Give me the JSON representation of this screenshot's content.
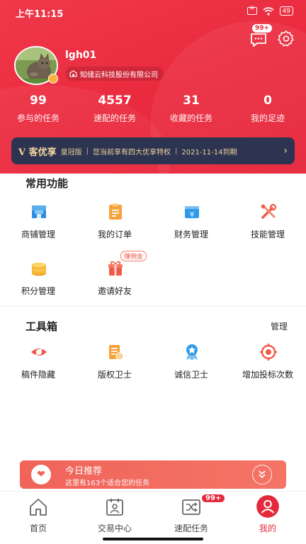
{
  "status": {
    "time": "上午11:15",
    "battery": "49"
  },
  "header": {
    "message_badge": "99+"
  },
  "profile": {
    "username": "lgh01",
    "company": "知储云科技股份有限公司"
  },
  "stats": [
    {
      "value": "99",
      "label": "参与的任务"
    },
    {
      "value": "4557",
      "label": "速配的任务"
    },
    {
      "value": "31",
      "label": "收藏的任务"
    },
    {
      "value": "0",
      "label": "我的足迹"
    }
  ],
  "vip": {
    "logo": "V 客优享",
    "tier": "皇冠版",
    "desc": "您当前享有四大优享特权",
    "expire": "2021-11-14到期",
    "sep": "|"
  },
  "common": {
    "title": "常用功能",
    "items": [
      {
        "label": "商铺管理",
        "icon": "store-icon"
      },
      {
        "label": "我的订单",
        "icon": "order-icon"
      },
      {
        "label": "财务管理",
        "icon": "finance-icon"
      },
      {
        "label": "技能管理",
        "icon": "skill-tools-icon"
      },
      {
        "label": "积分管理",
        "icon": "coins-icon"
      },
      {
        "label": "邀请好友",
        "icon": "gift-icon",
        "badge": "赚佣金"
      }
    ]
  },
  "toolbox": {
    "title": "工具箱",
    "manage": "管理",
    "items": [
      {
        "label": "稿件隐藏",
        "icon": "eye-hidden-icon"
      },
      {
        "label": "版权卫士",
        "icon": "copyright-icon"
      },
      {
        "label": "诚信卫士",
        "icon": "medal-icon"
      },
      {
        "label": "增加投标次数",
        "icon": "target-icon"
      }
    ]
  },
  "recommend": {
    "title": "今日推荐",
    "subtitle": "这里有163个适合您的任务"
  },
  "tabbar": [
    {
      "label": "首页",
      "icon": "home-icon"
    },
    {
      "label": "交易中心",
      "icon": "trade-center-icon"
    },
    {
      "label": "速配任务",
      "icon": "shuffle-icon",
      "badge": "99+"
    },
    {
      "label": "我的",
      "icon": "user-icon",
      "active": true
    }
  ],
  "colors": {
    "primary": "#e5293d",
    "vip_bg": "#2c3451",
    "vip_text": "#f0d39b",
    "icon_blue": "#2f9bea",
    "icon_orange": "#f7a13a",
    "icon_red": "#ef5a47"
  }
}
